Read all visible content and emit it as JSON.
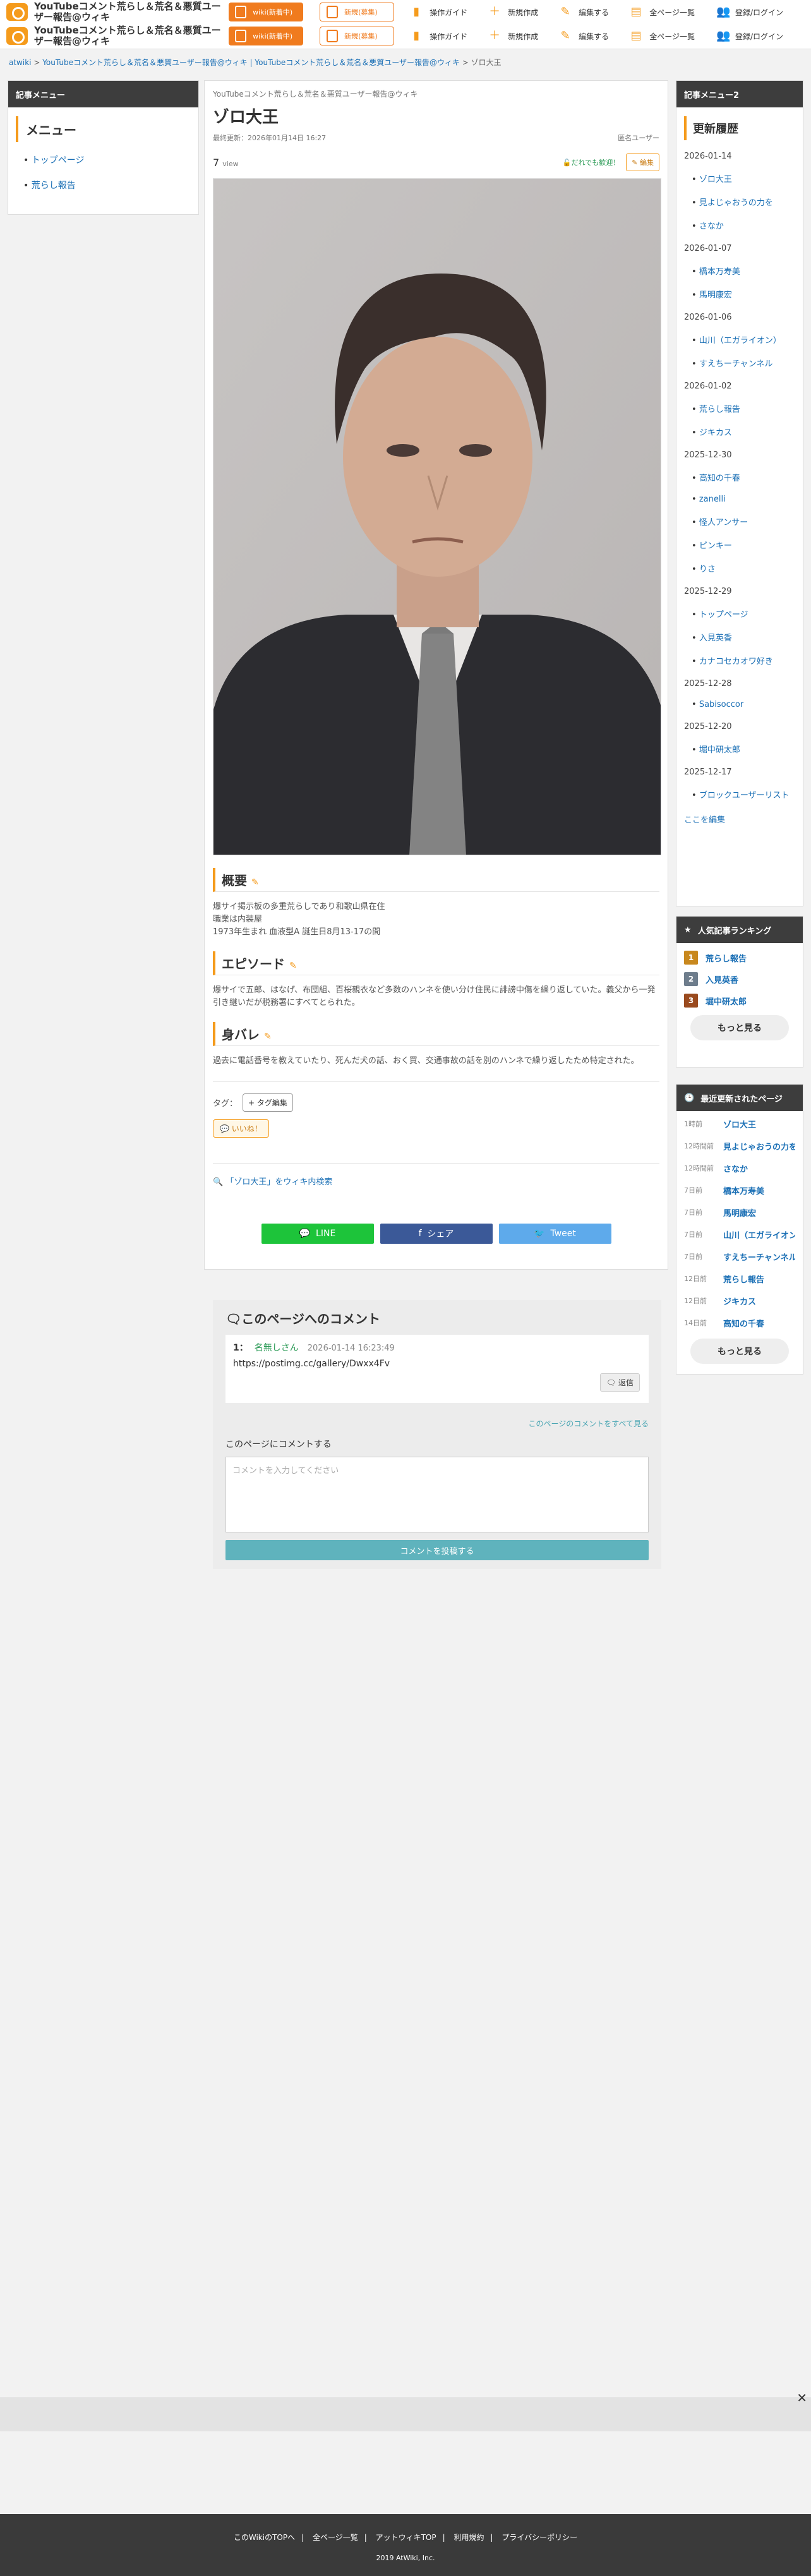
{
  "header": {
    "site_title": "YouTubeコメント荒らし＆荒名＆悪質ユーザー報告@ウィキ",
    "wiki_new_label": "wiki(新着中)",
    "recruit_label": "新規(募集)",
    "nav": [
      {
        "label": "操作ガイド",
        "icon": "book-icon"
      },
      {
        "label": "新規作成",
        "icon": "plus-icon"
      },
      {
        "label": "編集する",
        "icon": "pencil-icon"
      },
      {
        "label": "全ページ一覧",
        "icon": "page-icon"
      },
      {
        "label": "登録/ログイン",
        "icon": "users-icon"
      }
    ]
  },
  "breadcrumb": {
    "root": "atwiki",
    "parent": "YouTubeコメント荒らし＆荒名＆悪質ユーザー報告@ウィキ | YouTubeコメント荒らし＆荒名＆悪質ユーザー報告@ウィキ",
    "current": "ゾロ大王"
  },
  "left_menu": {
    "header": "記事メニュー",
    "title": "メニュー",
    "items": [
      "トップページ",
      "荒らし報告"
    ]
  },
  "article": {
    "kicker": "YouTubeコメント荒らし＆荒名＆悪質ユーザー報告@ウィキ",
    "title": "ゾロ大王",
    "updated": "最終更新：2026年01月14日 16:27",
    "author": "匿名ユーザー",
    "views": "7",
    "views_unit": "view",
    "anyone_edit": "だれでも歓迎！",
    "edit_label": "編集",
    "sections": [
      {
        "title": "概要",
        "body": "爆サイ掲示板の多重荒らしであり和歌山県在住\n職業は内装屋\n1973年生まれ 血液型A 誕生日8月13-17の間"
      },
      {
        "title": "エピソード",
        "body": "爆サイで五郎、はなげ、布団組、百桜親衣など多数のハンネを使い分け住民に誹謗中傷を繰り返していた。義父から一発引き継いだが税務署にすべてとられた。"
      },
      {
        "title": "身バレ",
        "body": "過去に電話番号を教えていたり、死んだ犬の話、おく買、交通事故の話を別のハンネで繰り返したため特定された。"
      }
    ],
    "tags_label": "タグ：",
    "tag_edit": "+ タグ編集",
    "like_label": "いいね！",
    "search_link": "「ゾロ大王」をウィキ内検索",
    "share": [
      {
        "label": "LINE",
        "color": "#1dc43a"
      },
      {
        "label": "シェア",
        "color": "#3b5998"
      },
      {
        "label": "Tweet",
        "color": "#5eaaeb"
      }
    ]
  },
  "comments": {
    "title": "このページへのコメント",
    "items": [
      {
        "num": "1：",
        "name": "名無しさん",
        "date": "2026-01-14 16:23:49",
        "text": "https://postimg.cc/gallery/Dwxx4Fv",
        "reply": "返信"
      }
    ],
    "all_link": "このページのコメントをすべて見る",
    "form_label": "このページにコメントする",
    "placeholder": "コメントを入力してください",
    "submit": "コメントを投稿する"
  },
  "right_menu": {
    "header": "記事メニュー2",
    "title": "更新履歴",
    "groups": [
      {
        "date": "2026-01-14",
        "items": [
          "ゾロ大王",
          "見よじゃおうの力を",
          "さなか"
        ]
      },
      {
        "date": "2026-01-07",
        "items": [
          "橋本万寿美",
          "馬明康宏"
        ]
      },
      {
        "date": "2026-01-06",
        "items": [
          "山川（エガライオン）",
          "すえちーチャンネル"
        ]
      },
      {
        "date": "2026-01-02",
        "items": [
          "荒らし報告",
          "ジキカス"
        ]
      },
      {
        "date": "2025-12-30",
        "items": [
          "高知の千春",
          "zanelli",
          "怪人アンサー",
          "ピンキー",
          "りさ"
        ]
      },
      {
        "date": "2025-12-29",
        "items": [
          "トップページ",
          "入見英香",
          "カナコセカオワ好き"
        ]
      },
      {
        "date": "2025-12-28",
        "items": [
          "Sabisoccor"
        ]
      },
      {
        "date": "2025-12-20",
        "items": [
          "堀中研太郎"
        ]
      },
      {
        "date": "2025-12-17",
        "items": [
          "ブロックユーザーリスト"
        ]
      }
    ],
    "here_edit": "ここを編集"
  },
  "ranking": {
    "header": "人気記事ランキング",
    "items": [
      {
        "rank": "1",
        "title": "荒らし報告",
        "color": "#c8881e"
      },
      {
        "rank": "2",
        "title": "入見英香",
        "color": "#6e7d8c"
      },
      {
        "rank": "3",
        "title": "堀中研太郎",
        "color": "#9a4a1e"
      }
    ],
    "more": "もっと見る"
  },
  "recent": {
    "header": "最近更新されたページ",
    "items": [
      {
        "ago": "1時前",
        "title": "ゾロ大王"
      },
      {
        "ago": "12時間前",
        "title": "見よじゃおうの力を"
      },
      {
        "ago": "12時間前",
        "title": "さなか"
      },
      {
        "ago": "7日前",
        "title": "橋本万寿美"
      },
      {
        "ago": "7日前",
        "title": "馬明康宏"
      },
      {
        "ago": "7日前",
        "title": "山川（エガライオン）"
      },
      {
        "ago": "7日前",
        "title": "すえちーチャンネル"
      },
      {
        "ago": "12日前",
        "title": "荒らし報告"
      },
      {
        "ago": "12日前",
        "title": "ジキカス"
      },
      {
        "ago": "14日前",
        "title": "高知の千春"
      }
    ],
    "more": "もっと見る"
  },
  "footer": {
    "links": [
      "このWikiのTOPへ",
      "全ページ一覧",
      "アットウィキTOP",
      "利用規約",
      "プライバシーポリシー"
    ],
    "copyright": "2019 AtWiki, Inc."
  }
}
